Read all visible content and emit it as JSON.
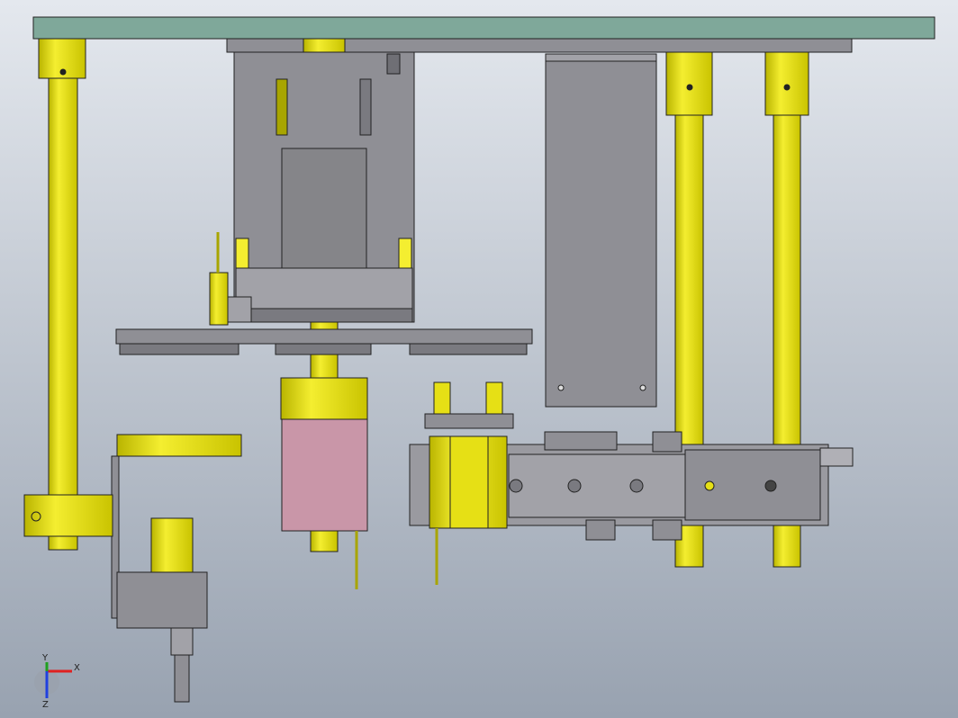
{
  "viewport": {
    "background_top": "#e4e8ee",
    "background_bottom": "#98a2b0"
  },
  "colors": {
    "plate": "#7fa89a",
    "yellow": "#e6e015",
    "yellow_dark": "#a8a500",
    "steel": "#8f8f95",
    "steel_dark": "#6f6f75",
    "pink": "#c996a8",
    "outline": "#222222"
  },
  "triad": {
    "x_label": "X",
    "y_label": "Y",
    "z_label": "Z",
    "x_color": "#e02020",
    "y_color": "#20a020",
    "z_color": "#2040e0"
  }
}
